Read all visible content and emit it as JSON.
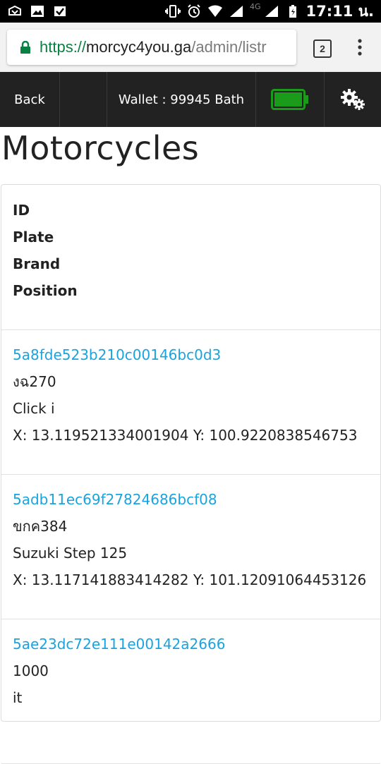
{
  "status_bar": {
    "time": "17:11 น.",
    "network": "4G",
    "left_icons": [
      "notification-icon",
      "image-icon",
      "check-icon"
    ],
    "right_icons": [
      "vibrate-icon",
      "alarm-icon",
      "wifi-icon",
      "signal-icon",
      "battery-icon"
    ]
  },
  "browser": {
    "url_scheme": "https://",
    "url_host": "morcyc4you.ga",
    "url_path": "/admin/listr",
    "tab_count": "2"
  },
  "nav": {
    "back_label": "Back",
    "wallet_label": "Wallet : 99945 Bath",
    "battery_color": "#1a9c1a"
  },
  "page": {
    "title": "Motorcycles"
  },
  "table": {
    "headers": [
      "ID",
      "Plate",
      "Brand",
      "Position"
    ],
    "rows": [
      {
        "id": "5a8fde523b210c00146bc0d3",
        "plate": "งฉ270",
        "brand": "Click i",
        "position": "X: 13.119521334001904 Y: 100.9220838546753"
      },
      {
        "id": "5adb11ec69f27824686bcf08",
        "plate": "ขกค384",
        "brand": "Suzuki Step 125",
        "position": "X: 13.117141883414282 Y: 101.12091064453126"
      },
      {
        "id": "5ae23dc72e111e00142a2666",
        "plate": "1000",
        "brand": "it",
        "position": ""
      }
    ]
  },
  "colors": {
    "link": "#1aa3de",
    "nav_bg": "#222222",
    "url_scheme": "#0b8043"
  }
}
